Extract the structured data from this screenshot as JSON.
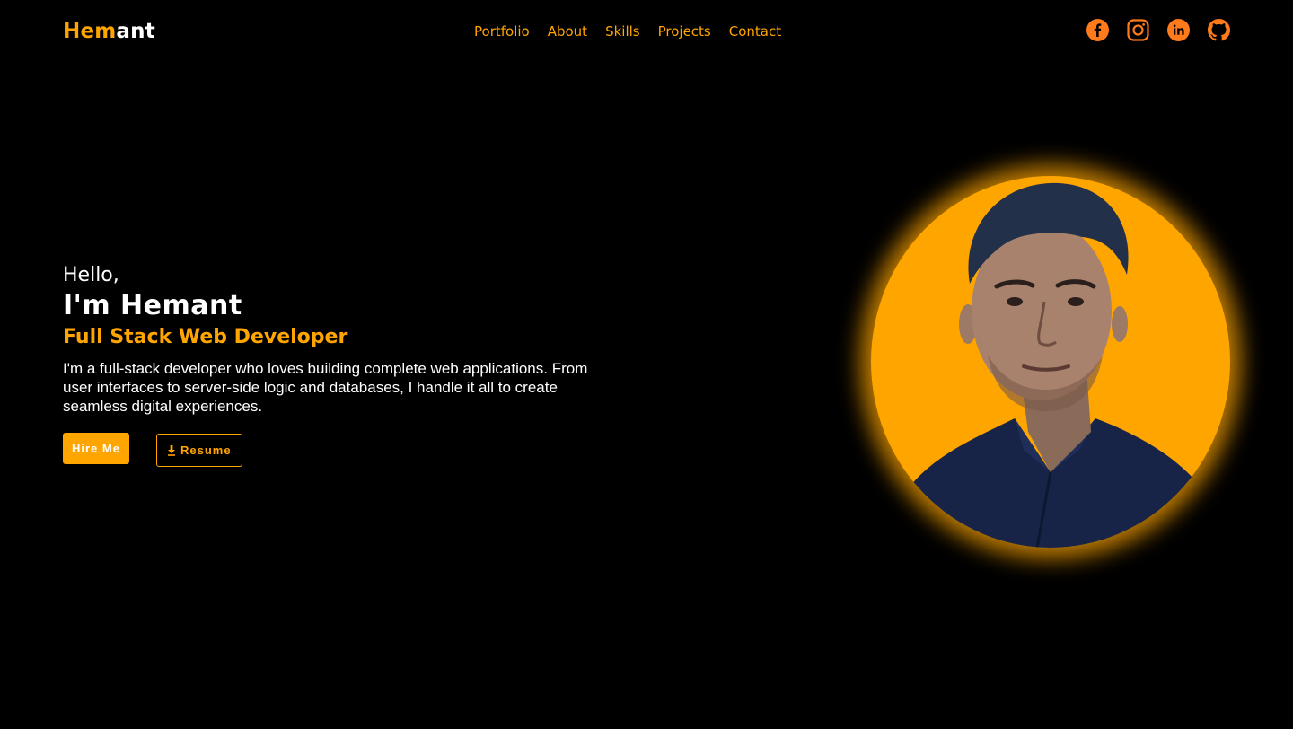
{
  "header": {
    "logo": {
      "accent": "Hem",
      "rest": "ant"
    },
    "nav": [
      "Portfolio",
      "About",
      "Skills",
      "Projects",
      "Contact"
    ],
    "socials": [
      {
        "icon": "facebook-icon"
      },
      {
        "icon": "instagram-icon"
      },
      {
        "icon": "linkedin-icon"
      },
      {
        "icon": "github-icon"
      }
    ]
  },
  "hero": {
    "greeting": "Hello,",
    "name": "I'm Hemant",
    "role": "Full Stack Web Developer",
    "description": "I'm a full-stack developer who loves building complete web applications. From user interfaces to server-side logic and databases, I handle it all to create seamless digital experiences.",
    "buttons": {
      "hire": "Hire Me",
      "resume": "Resume",
      "resume_icon": "download-icon"
    },
    "portrait_icon": "profile-photo"
  },
  "colors": {
    "accent": "#FFA500",
    "icon": "#FF7A1A",
    "background": "#000000",
    "text": "#FFFFFF"
  }
}
